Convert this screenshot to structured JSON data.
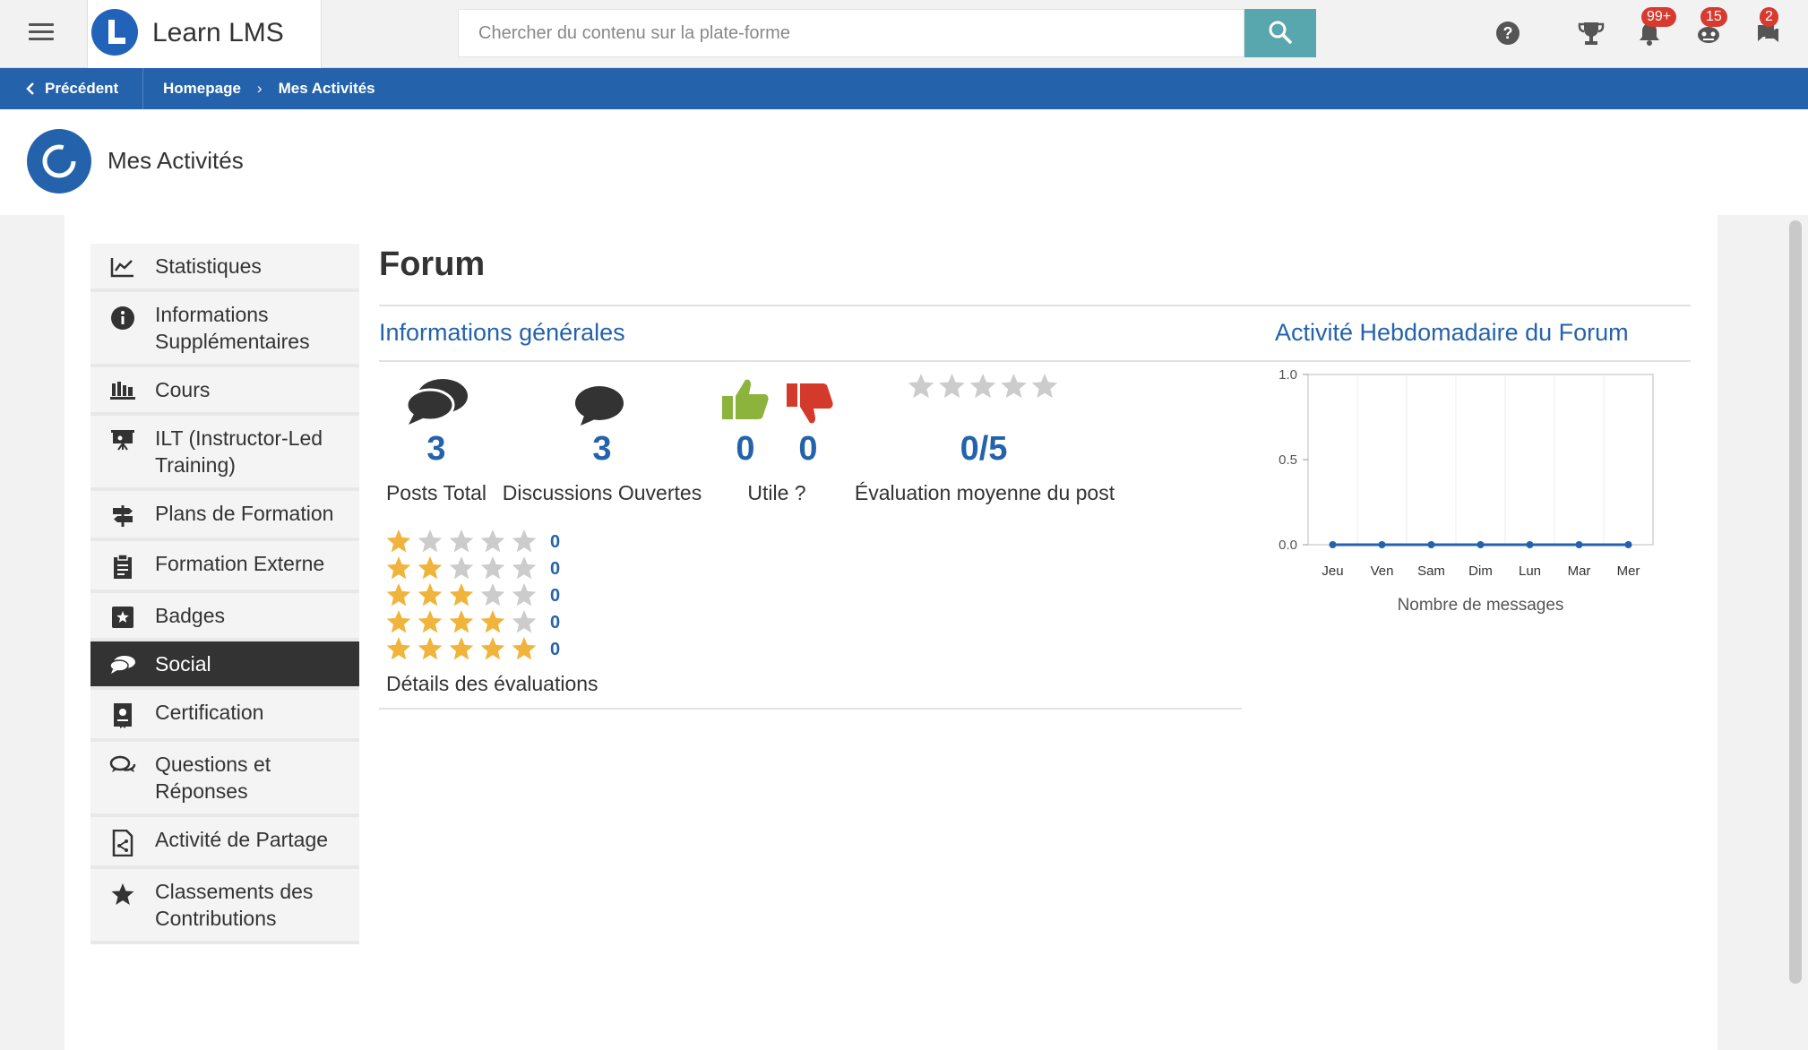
{
  "topbar": {
    "brand": "Learn LMS",
    "search_placeholder": "Chercher du contenu sur la plate-forme",
    "icons": [
      "help-icon",
      "trophy-icon",
      "bell-icon",
      "robot-icon",
      "messages-icon"
    ],
    "notifications_badge": "99+",
    "robot_badge": "15",
    "messages_badge": "2"
  },
  "breadcrumb": {
    "back_label": "Précédent",
    "items": [
      "Homepage",
      "Mes Activités"
    ]
  },
  "page": {
    "title": "Mes Activités"
  },
  "sidebar": {
    "items": [
      {
        "label": "Statistiques",
        "icon": "chart-line-icon"
      },
      {
        "label": "Informations Supplémentaires",
        "icon": "info-icon"
      },
      {
        "label": "Cours",
        "icon": "courses-icon"
      },
      {
        "label": "ILT (Instructor-Led Training)",
        "icon": "presentation-icon"
      },
      {
        "label": "Plans de Formation",
        "icon": "signpost-icon"
      },
      {
        "label": "Formation Externe",
        "icon": "clipboard-icon"
      },
      {
        "label": "Badges",
        "icon": "badge-icon"
      },
      {
        "label": "Social",
        "icon": "chat-bubbles-icon"
      },
      {
        "label": "Certification",
        "icon": "certificate-icon"
      },
      {
        "label": "Questions et Réponses",
        "icon": "qa-icon"
      },
      {
        "label": "Activité de Partage",
        "icon": "share-doc-icon"
      },
      {
        "label": "Classements des Contributions",
        "icon": "star-icon"
      }
    ],
    "active": "Social"
  },
  "main": {
    "title": "Forum",
    "general_title": "Informations générales",
    "weekly_title": "Activité Hebdomadaire du Forum",
    "stats": {
      "posts_total": "3",
      "posts_total_label": "Posts Total",
      "open_discussions": "3",
      "open_discussions_label": "Discussions Ouvertes",
      "useful_yes": "0",
      "useful_no": "0",
      "useful_label": "Utile ?",
      "avg_rating": "0/5",
      "avg_rating_value": 0,
      "avg_rating_label": "Évaluation moyenne du post"
    },
    "rating_details": [
      {
        "stars": 1,
        "count": "0"
      },
      {
        "stars": 2,
        "count": "0"
      },
      {
        "stars": 3,
        "count": "0"
      },
      {
        "stars": 4,
        "count": "0"
      },
      {
        "stars": 5,
        "count": "0"
      }
    ],
    "rating_details_label": "Détails des évaluations"
  },
  "colors": {
    "primary": "#2463ab",
    "active_bg": "#333333",
    "star": "#f0b43c",
    "star_empty": "#cccccc",
    "thumb_up": "#8cb43c",
    "thumb_down": "#d33a2c"
  },
  "chart_data": {
    "type": "line",
    "categories": [
      "Jeu",
      "Ven",
      "Sam",
      "Dim",
      "Lun",
      "Mar",
      "Mer"
    ],
    "series": [
      {
        "values": [
          0,
          0,
          0,
          0,
          0,
          0,
          0
        ]
      }
    ],
    "xlabel": "Nombre de messages",
    "ylabel": "",
    "ylim": [
      0,
      1
    ],
    "yticks": [
      "0.0",
      "0.5",
      "1.0"
    ],
    "grid": true
  }
}
